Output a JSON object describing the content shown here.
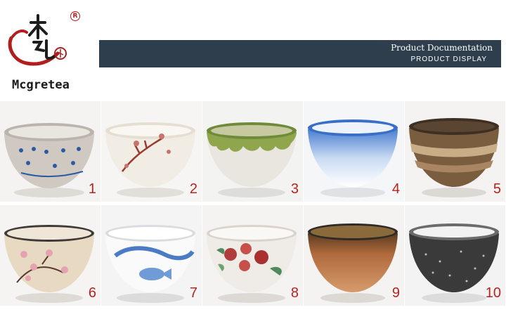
{
  "brand": {
    "name": "Mcgretea",
    "registered_mark": "R",
    "accent_color": "#b01e1e"
  },
  "header": {
    "title": "Product Documentation",
    "subtitle": "PRODUCT DISPLAY",
    "bar_color": "#2f3e4c"
  },
  "products": [
    {
      "number": "1",
      "style": "grey speckled glaze with blue dot pattern"
    },
    {
      "number": "2",
      "style": "white glaze with red plum branch"
    },
    {
      "number": "3",
      "style": "green drip glaze over white"
    },
    {
      "number": "4",
      "style": "blue to white gradient glaze"
    },
    {
      "number": "5",
      "style": "brown banded glaze"
    },
    {
      "number": "6",
      "style": "beige crackle glaze with pink blossoms"
    },
    {
      "number": "7",
      "style": "white glaze with blue painted fish"
    },
    {
      "number": "8",
      "style": "white glaze with red and green floral"
    },
    {
      "number": "9",
      "style": "brown kiln-change glaze"
    },
    {
      "number": "10",
      "style": "black speckled glaze with white rim"
    }
  ],
  "labels_color": "#b7231f"
}
